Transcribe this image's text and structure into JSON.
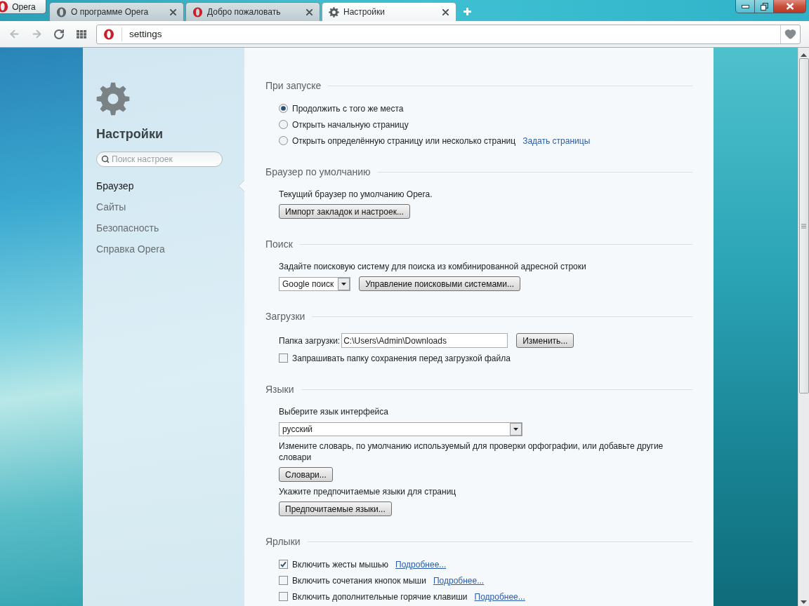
{
  "window": {
    "app_button": "Opera",
    "tabs": [
      {
        "label": "О программе Opera",
        "kind": "about",
        "selected": false
      },
      {
        "label": "Добро пожаловать",
        "kind": "welcome",
        "selected": false
      },
      {
        "label": "Настройки",
        "kind": "settings",
        "selected": true
      }
    ]
  },
  "toolbar": {
    "back": {
      "disabled": true
    },
    "forward": {
      "disabled": true
    },
    "address": "settings"
  },
  "sidebar": {
    "title": "Настройки",
    "search": {
      "placeholder": "Поиск настроек"
    },
    "items": [
      {
        "label": "Браузер",
        "selected": true
      },
      {
        "label": "Сайты",
        "selected": false
      },
      {
        "label": "Безопасность",
        "selected": false
      },
      {
        "label": "Справка Opera",
        "selected": false
      }
    ]
  },
  "sections": [
    {
      "heading": "При запуске",
      "rows": [
        {
          "kind": "radio",
          "label": "Продолжить с того же места",
          "selected": true
        },
        {
          "kind": "radio",
          "label": "Открыть начальную страницу",
          "selected": false
        },
        {
          "kind": "radio",
          "label": "Открыть определённую страницу или несколько страниц",
          "selected": false,
          "link": {
            "text": "Задать страницы",
            "underlined": false
          }
        }
      ]
    },
    {
      "heading": "Браузер по умолчанию",
      "rows": [
        {
          "kind": "text",
          "text": "Текущий браузер по умолчанию Opera."
        },
        {
          "kind": "controls",
          "controls": [
            {
              "kind": "button",
              "label": "Импорт закладок и настроек..."
            }
          ]
        }
      ]
    },
    {
      "heading": "Поиск",
      "rows": [
        {
          "kind": "text",
          "text": "Задайте поисковую систему для поиска из комбинированной адресной строки"
        },
        {
          "kind": "controls",
          "controls": [
            {
              "kind": "select",
              "value": "Google поиск",
              "wide": false
            },
            {
              "kind": "button",
              "label": "Управление поисковыми системами..."
            }
          ]
        }
      ]
    },
    {
      "heading": "Загрузки",
      "rows": [
        {
          "kind": "controls",
          "controls": [
            {
              "kind": "label",
              "text": "Папка загрузки:"
            },
            {
              "kind": "input",
              "value": "C:\\Users\\Admin\\Downloads"
            },
            {
              "kind": "button",
              "label": "Изменить..."
            }
          ]
        },
        {
          "kind": "checkbox",
          "label": "Запрашивать папку сохранения перед загрузкой файла",
          "checked": false
        }
      ]
    },
    {
      "heading": "Языки",
      "rows": [
        {
          "kind": "text",
          "text": "Выберите язык интерфейса"
        },
        {
          "kind": "controls",
          "controls": [
            {
              "kind": "select",
              "value": "русский",
              "wide": true
            }
          ]
        },
        {
          "kind": "text",
          "text": "Измените словарь, по умолчанию используемый для проверки орфографии, или добавьте другие словари"
        },
        {
          "kind": "controls",
          "controls": [
            {
              "kind": "button",
              "label": "Словари..."
            }
          ]
        },
        {
          "kind": "text",
          "text": "Укажите предпочитаемые языки для страниц"
        },
        {
          "kind": "controls",
          "controls": [
            {
              "kind": "button",
              "label": "Предпочитаемые языки..."
            }
          ]
        }
      ]
    },
    {
      "heading": "Ярлыки",
      "rows": [
        {
          "kind": "checkbox",
          "label": "Включить жесты мышью",
          "checked": true,
          "link": {
            "text": "Подробнее...",
            "underlined": true
          }
        },
        {
          "kind": "checkbox",
          "label": "Включить сочетания кнопок мыши",
          "checked": false,
          "link": {
            "text": "Подробнее...",
            "underlined": true
          }
        },
        {
          "kind": "checkbox",
          "label": "Включить дополнительные горячие клавиши",
          "checked": false,
          "link": {
            "text": "Подробнее...",
            "underlined": true
          }
        }
      ]
    }
  ]
}
